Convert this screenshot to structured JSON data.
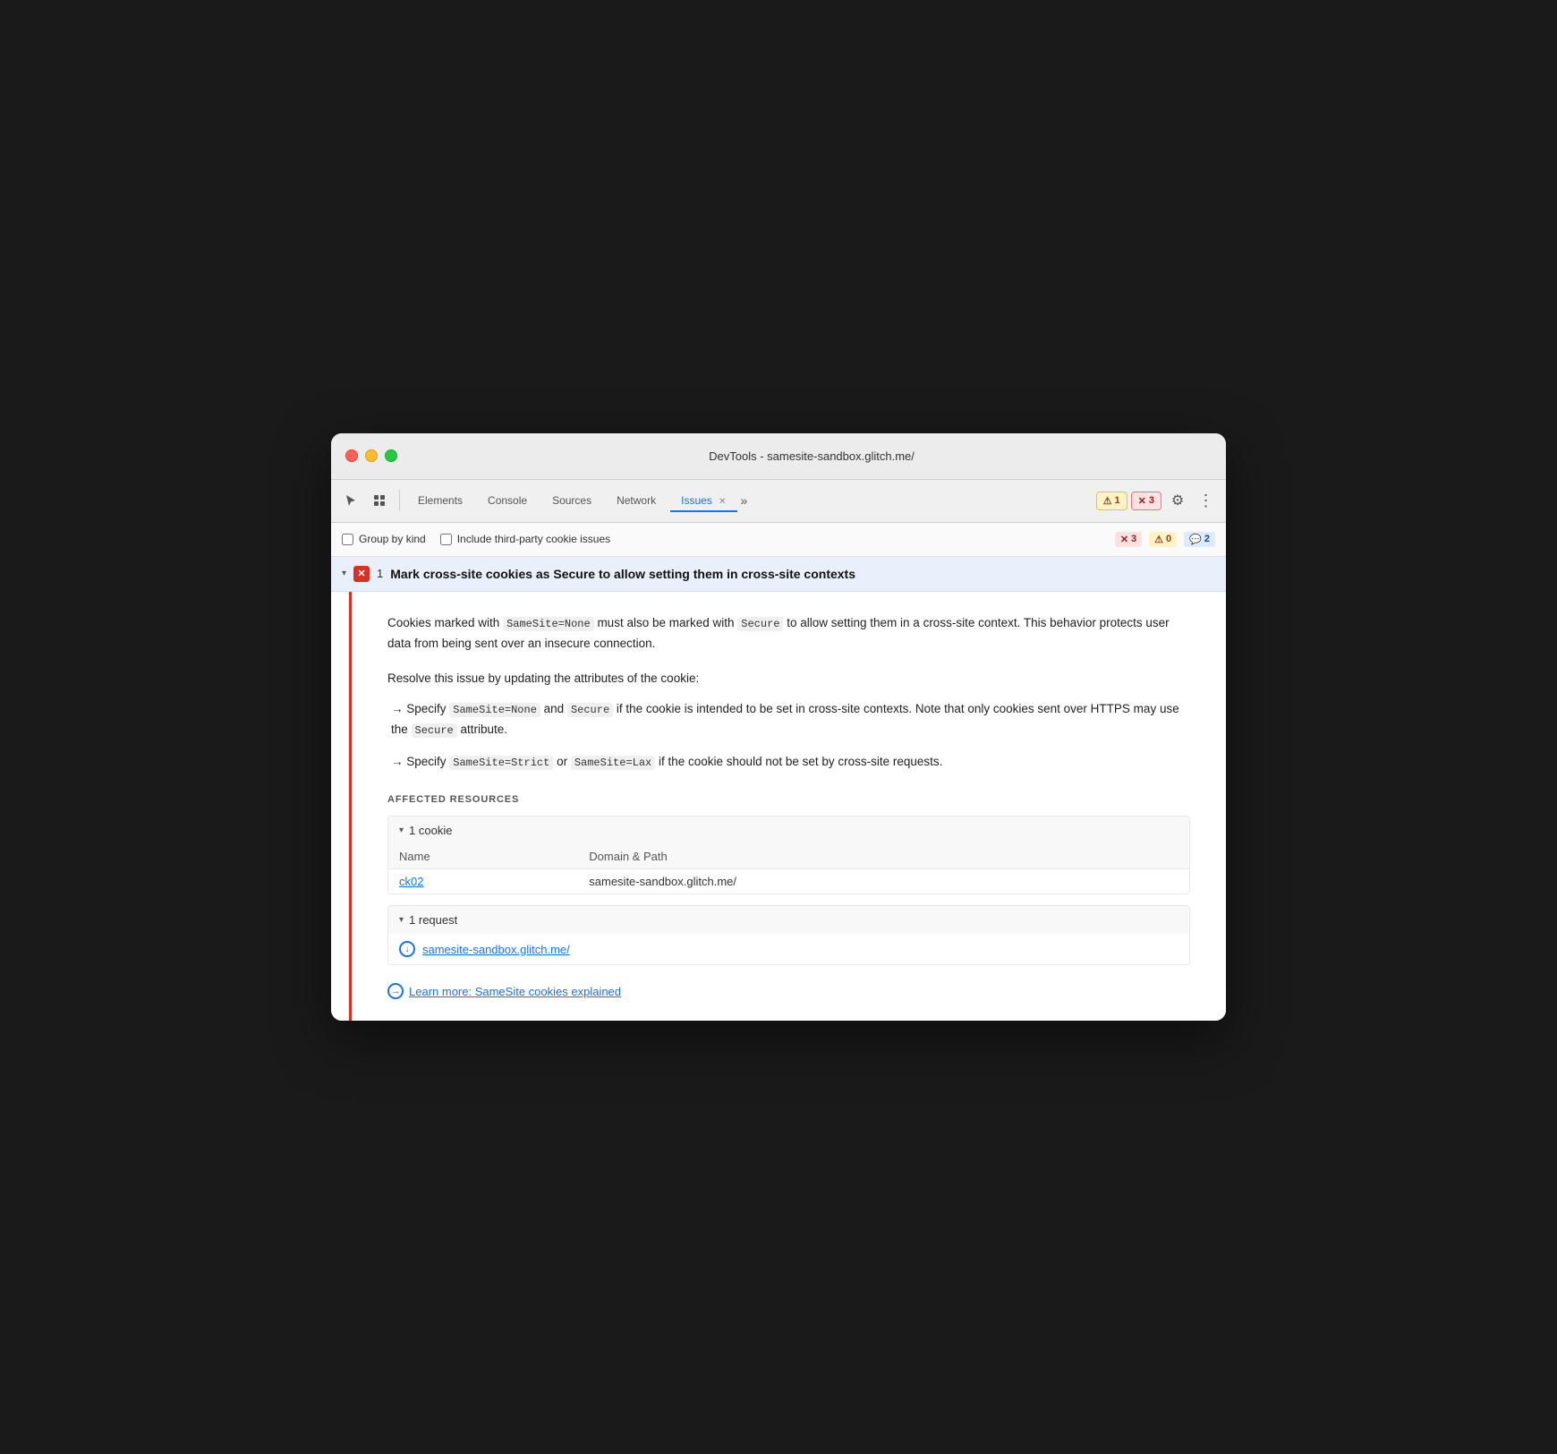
{
  "window": {
    "title": "DevTools - samesite-sandbox.glitch.me/"
  },
  "toolbar": {
    "cursor_icon": "⊹",
    "layers_icon": "⧉",
    "tabs": [
      {
        "id": "elements",
        "label": "Elements",
        "active": false,
        "closable": false
      },
      {
        "id": "console",
        "label": "Console",
        "active": false,
        "closable": false
      },
      {
        "id": "sources",
        "label": "Sources",
        "active": false,
        "closable": false
      },
      {
        "id": "network",
        "label": "Network",
        "active": false,
        "closable": false
      },
      {
        "id": "issues",
        "label": "Issues",
        "active": true,
        "closable": true
      }
    ],
    "more_tabs_label": "»",
    "badge_warning_count": "1",
    "badge_error_count": "3",
    "gear_icon": "⚙",
    "dots_icon": "⋮"
  },
  "filter_bar": {
    "group_by_kind_label": "Group by kind",
    "third_party_label": "Include third-party cookie issues",
    "count_error": "3",
    "count_warning": "0",
    "count_info": "2",
    "error_icon": "✕",
    "warning_icon": "⚠",
    "info_icon": "💬"
  },
  "issue": {
    "title": "Mark cross-site cookies as Secure to allow setting them in cross-site contexts",
    "count": "1",
    "description_parts": [
      {
        "type": "text",
        "content": "Cookies marked with "
      },
      {
        "type": "code",
        "content": "SameSite=None"
      },
      {
        "type": "text",
        "content": " must also be marked with "
      },
      {
        "type": "code",
        "content": "Secure"
      },
      {
        "type": "text",
        "content": " to allow setting them in a cross-site context. This behavior protects user data from being sent over an insecure connection."
      }
    ],
    "resolve_intro": "Resolve this issue by updating the attributes of the cookie:",
    "suggestions": [
      {
        "arrow": "→",
        "prefix": "Specify ",
        "code1": "SameSite=None",
        "mid": " and ",
        "code2": "Secure",
        "suffix": " if the cookie is intended to be set in cross-site contexts. Note that only cookies sent over HTTPS may use the ",
        "code3": "Secure",
        "end": " attribute."
      },
      {
        "arrow": "→",
        "prefix": "Specify ",
        "code1": "SameSite=Strict",
        "mid": " or ",
        "code2": "SameSite=Lax",
        "suffix": " if the cookie should not be set by cross-site requests."
      }
    ],
    "affected_resources_title": "AFFECTED RESOURCES",
    "cookie_section": {
      "label": "1 cookie",
      "table_headers": [
        "Name",
        "Domain & Path"
      ],
      "rows": [
        {
          "name": "ck02",
          "domain_path": "samesite-sandbox.glitch.me/"
        }
      ]
    },
    "request_section": {
      "label": "1 request",
      "url": "samesite-sandbox.glitch.me/"
    },
    "learn_more": {
      "label": "Learn more: SameSite cookies explained",
      "url": "#"
    }
  },
  "icons": {
    "chevron_down": "▾",
    "chevron_right": "▸",
    "arrow_right": "→",
    "request_arrow": "↓"
  }
}
